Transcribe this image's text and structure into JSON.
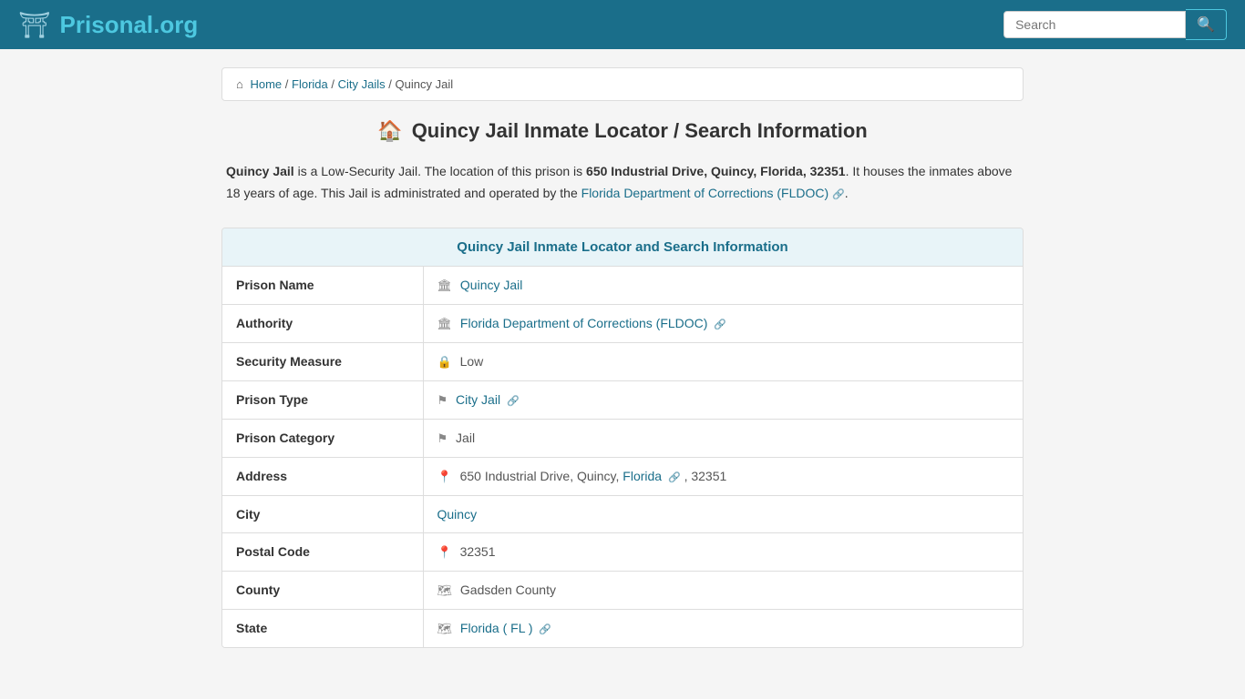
{
  "header": {
    "logo_text": "Prisonal",
    "logo_ext": ".org",
    "search_placeholder": "Search"
  },
  "breadcrumb": {
    "home": "Home",
    "florida": "Florida",
    "city_jails": "City Jails",
    "current": "Quincy Jail"
  },
  "page": {
    "title": "Quincy Jail Inmate Locator / Search Information",
    "description_part1": " is a Low-Security Jail. The location of this prison is ",
    "description_address_bold": "650 Industrial Drive, Quincy, Florida, 32351",
    "description_part2": ". It houses the inmates above 18 years of age. This Jail is administrated and operated by the ",
    "description_link": "Florida Department of Corrections (FLDOC)",
    "description_end": "."
  },
  "table_section": {
    "header": "Quincy Jail Inmate Locator and Search Information",
    "rows": [
      {
        "label": "Prison Name",
        "value": "Quincy Jail",
        "is_link": true,
        "icon": "🏛"
      },
      {
        "label": "Authority",
        "value": "Florida Department of Corrections (FLDOC)",
        "is_link": true,
        "has_ext": true,
        "icon": "🏛"
      },
      {
        "label": "Security Measure",
        "value": "Low",
        "icon": "🔒"
      },
      {
        "label": "Prison Type",
        "value": "City Jail",
        "is_link": true,
        "has_ext": true,
        "icon": "📌"
      },
      {
        "label": "Prison Category",
        "value": "Jail",
        "icon": "📌"
      },
      {
        "label": "Address",
        "value": "650 Industrial Drive, Quincy, Florida",
        "value2": ", 32351",
        "has_map": true,
        "icon": "📍"
      },
      {
        "label": "City",
        "value": "Quincy",
        "is_link": true
      },
      {
        "label": "Postal Code",
        "value": "32351",
        "icon": "📍"
      },
      {
        "label": "County",
        "value": "Gadsden County",
        "icon": "🗺"
      },
      {
        "label": "State",
        "value": "Florida ( FL )",
        "is_link": true,
        "has_ext": true,
        "icon": "🗺"
      }
    ]
  },
  "colors": {
    "header_bg": "#1a6e8a",
    "accent": "#4dc8e0",
    "link": "#1a6e8a"
  }
}
